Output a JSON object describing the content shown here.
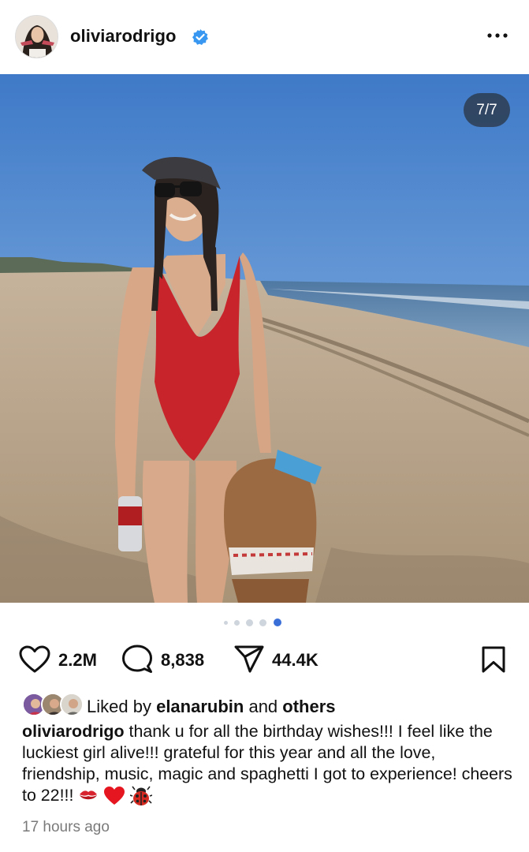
{
  "post": {
    "username": "oliviarodrigo",
    "verified": true,
    "more_icon": "more-horizontal-icon",
    "image_counter": "7/7",
    "carousel": {
      "total_visible_dots": 5,
      "active_index": 4
    },
    "actions": {
      "like_count": "2.2M",
      "comment_count": "8,838",
      "share_count": "44.4K"
    },
    "liked_by": {
      "prefix": "Liked by",
      "user": "elanarubin",
      "conjunction": "and",
      "others": "others"
    },
    "caption": {
      "username": "oliviarodrigo",
      "text": "thank u for all the birthday wishes!!! I feel like the luckiest girl alive!!! grateful for this year and all the love, friendship, music, magic and spaghetti I got to experience! cheers to 22!!!",
      "emojis": [
        "kiss-mark-icon",
        "red-heart-icon",
        "ladybug-icon"
      ]
    },
    "timestamp": "17 hours ago"
  },
  "colors": {
    "verified_blue": "#3897f0",
    "active_dot": "#3b6fd8",
    "inactive_dot": "#cfd5dc",
    "muted_text": "#7a7a7a"
  }
}
